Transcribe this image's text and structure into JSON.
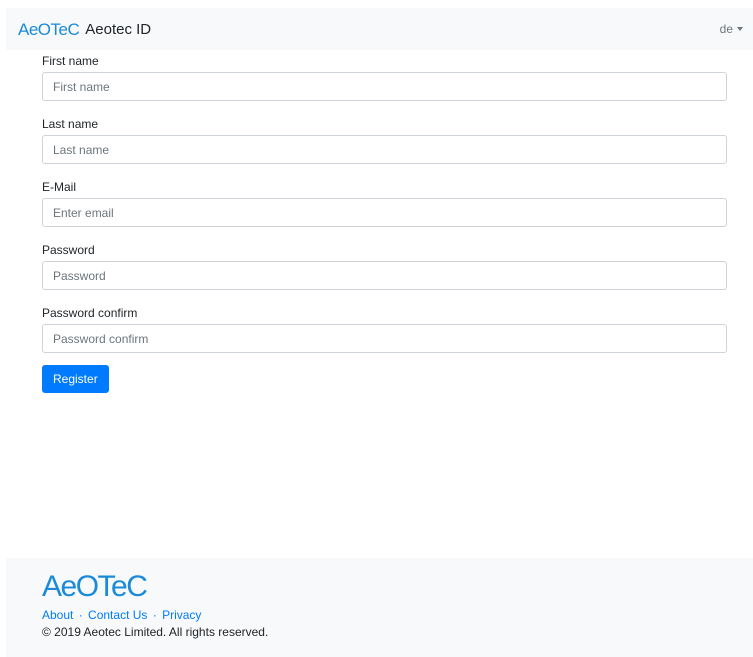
{
  "navbar": {
    "logo_text": "AeOTeC",
    "title": "Aeotec ID",
    "language": "de"
  },
  "form": {
    "fields": [
      {
        "label": "First name",
        "placeholder": "First name"
      },
      {
        "label": "Last name",
        "placeholder": "Last name"
      },
      {
        "label": "E-Mail",
        "placeholder": "Enter email"
      },
      {
        "label": "Password",
        "placeholder": "Password"
      },
      {
        "label": "Password confirm",
        "placeholder": "Password confirm"
      }
    ],
    "submit_label": "Register"
  },
  "footer": {
    "logo_text": "AeOTeC",
    "links": [
      "About",
      "Contact Us",
      "Privacy"
    ],
    "separator": "·",
    "copyright": "© 2019 Aeotec Limited. All rights reserved."
  },
  "colors": {
    "brand": "#1a8ad9",
    "primary": "#007bff",
    "navbar_bg": "#f8f9fa"
  }
}
